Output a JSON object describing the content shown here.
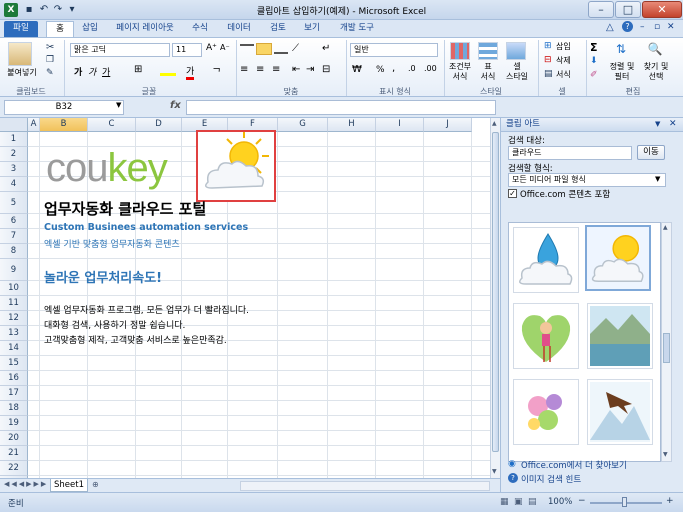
{
  "window": {
    "title": "클립아트 삽입하기(예제) - Microsoft Excel",
    "app_icon": "X"
  },
  "tabs": [
    {
      "label": "파일"
    },
    {
      "label": "홈"
    },
    {
      "label": "삽입"
    },
    {
      "label": "페이지 레이아웃"
    },
    {
      "label": "수식"
    },
    {
      "label": "데이터"
    },
    {
      "label": "검토"
    },
    {
      "label": "보기"
    },
    {
      "label": "개발 도구"
    }
  ],
  "ribbon": {
    "clipboard": {
      "paste": "붙여넣기",
      "group": "클립보드"
    },
    "font": {
      "name": "맑은 고딕",
      "size": "11",
      "bold": "가",
      "italic": "가",
      "underline": "가",
      "fontcolor": "가",
      "group": "글꼴"
    },
    "alignment": {
      "group": "맞춤"
    },
    "number": {
      "format": "일반",
      "percent": "%",
      "comma": ",",
      "group": "표시 형식"
    },
    "styles": {
      "conditional": "조건부\n서식",
      "table": "표\n서식",
      "cell": "셀\n스타일",
      "group": "스타일"
    },
    "cells": {
      "insert": "삽입",
      "delete": "삭제",
      "format": "서식",
      "group": "셀"
    },
    "editing": {
      "sort": "정렬 및\n필터",
      "find": "찾기 및\n선택",
      "sum": "Σ",
      "group": "편집"
    }
  },
  "formula": {
    "namebox": "B32",
    "fx": "fx",
    "value": ""
  },
  "grid": {
    "columns": [
      "A",
      "B",
      "C",
      "D",
      "E",
      "F",
      "G",
      "H",
      "I",
      "J"
    ],
    "rows": [
      "1",
      "2",
      "3",
      "4",
      "5",
      "6",
      "7",
      "8",
      "9",
      "10",
      "11",
      "12",
      "13",
      "14",
      "15",
      "16",
      "17",
      "18",
      "19",
      "20",
      "21",
      "22",
      "23"
    ],
    "logo": {
      "cou": "cou",
      "key": "key"
    },
    "cells": {
      "r5": "업무자동화 클라우드 포털",
      "r6": "Custom Businees automation services",
      "r7": "엑셀 기반 맞춤형 업무자동화 콘텐츠",
      "r9": "놀라운 업무처리속도!",
      "r11": "엑셀 업무자동화 프로그램, 모든 업무가 더 빨라집니다.",
      "r12": "대화형 검색, 사용하기 정말 쉽습니다.",
      "r13": "고객맞춤형 제작, 고객맞춤 서비스로 높은만족감."
    }
  },
  "sheet_tabs": {
    "sheet1": "Sheet1"
  },
  "status": {
    "ready": "준비",
    "zoom": "100%",
    "minus": "−",
    "plus": "+"
  },
  "clipart_pane": {
    "title": "클립 아트",
    "search_label": "검색 대상:",
    "search_value": "클라우드",
    "go_button": "이동",
    "type_label": "검색할 형식:",
    "type_value": "모든 미디어 파일 형식",
    "include_label": "Office.com 콘텐츠 포함",
    "more_link": "Office.com에서 더 찾아보기",
    "hint_link": "이미지 검색 힌트"
  },
  "colors": {
    "accent": "#1e395b",
    "logo_gray": "#9b9b9b",
    "logo_green": "#8cc63f",
    "blue_text": "#2e75b6",
    "highlight": "#e04040"
  }
}
